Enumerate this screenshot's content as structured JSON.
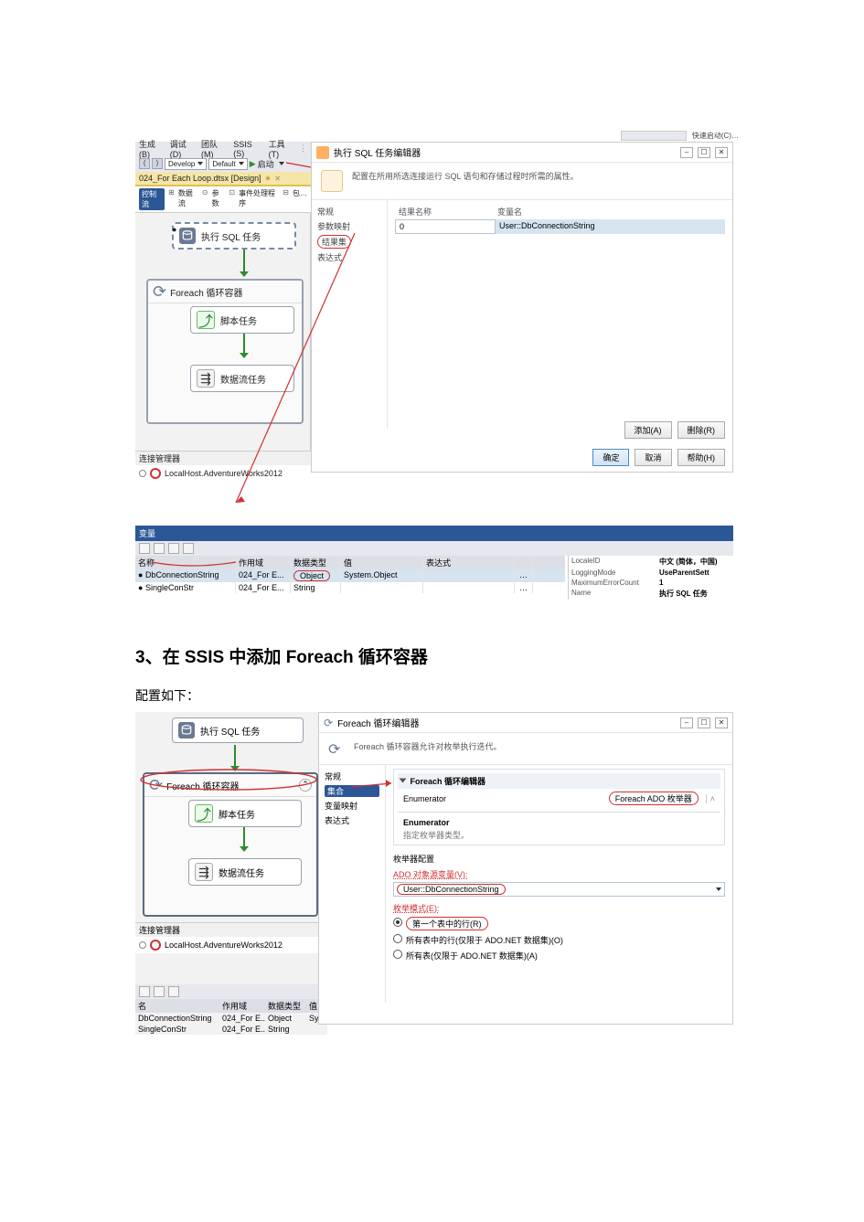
{
  "shot1": {
    "titlebar_hint": "快速启动(C)…",
    "menu": [
      "生成(B)",
      "调试(D)",
      "团队(M)",
      "SSIS (S)",
      "工具(T)"
    ],
    "toolbar": {
      "config": "Develop",
      "platform": "Default",
      "start": "启动"
    },
    "tab": "024_For Each Loop.dtsx [Design]",
    "subtabs": {
      "sel": "控制流",
      "others": [
        "数据流",
        "参数",
        "事件处理程序",
        "包…"
      ],
      "icons": [
        "⊞",
        "⊙",
        "⊡",
        "⊟"
      ]
    },
    "designer": {
      "sql_task": "执行 SQL 任务",
      "foreach": "Foreach 循环容器",
      "script": "脚本任务",
      "dataflow": "数据流任务"
    },
    "cm_label": "连接管理器",
    "connection": "LocalHost.AdventureWorks2012",
    "dialog": {
      "title": "执行 SQL 任务编辑器",
      "subtitle": "配置在所用所选连接运行 SQL 语句和存储过程时所需的属性。",
      "nav": [
        "常规",
        "参数映射",
        "结果集",
        "表达式"
      ],
      "col1": "结果名称",
      "col2": "变量名",
      "row_id": "0",
      "row_var": "User::DbConnectionString",
      "btn_add": "添加(A)",
      "btn_del": "删除(R)",
      "btn_ok": "确定",
      "btn_cancel": "取消",
      "btn_help": "帮助(H)"
    },
    "vars": {
      "title": "变量",
      "hdr": [
        "名称",
        "作用域",
        "数据类型",
        "值",
        "表达式",
        ""
      ],
      "rows": [
        {
          "name": "DbConnectionString",
          "scope": "024_For E...",
          "type": "Object",
          "value": "System.Object",
          "sel": true
        },
        {
          "name": "SingleConStr",
          "scope": "024_For E...",
          "type": "String",
          "value": "",
          "sel": false
        }
      ]
    },
    "props": {
      "rows": [
        {
          "k": "LocaleID",
          "v": "中文 (简体，中国)"
        },
        {
          "k": "LoggingMode",
          "v": "UseParentSett"
        },
        {
          "k": "MaximumErrorCount",
          "v": "1"
        },
        {
          "k": "Name",
          "v": "执行 SQL 任务"
        }
      ]
    }
  },
  "article": {
    "h3": "3、在 SSIS 中添加 Foreach 循环容器",
    "p1": "配置如下："
  },
  "shot2": {
    "designer": {
      "sql_task": "执行 SQL 任务",
      "foreach": "Foreach 循环容器",
      "script": "脚本任务",
      "dataflow": "数据流任务"
    },
    "cm_label": "连接管理器",
    "connection": "LocalHost.AdventureWorks2012",
    "dialog": {
      "title": "Foreach 循环编辑器",
      "subtitle": "Foreach 循环容器允许对枚举执行迭代。",
      "nav": [
        "常规",
        "集合",
        "变量映射",
        "表达式"
      ],
      "group": "Foreach 循环编辑器",
      "enum_label": "Enumerator",
      "enum_value": "Foreach ADO 枚举器",
      "enum_group": "Enumerator",
      "enum_desc": "指定枚举器类型。",
      "cfg_label": "枚举器配置",
      "ado_src_label": "ADO 对象源变量(V):",
      "ado_src_value": "User::DbConnectionString",
      "mode_label": "枚举模式(E):",
      "radio1": "第一个表中的行(R)",
      "radio2": "所有表中的行(仅限于 ADO.NET 数据集)(O)",
      "radio3": "所有表(仅限于 ADO.NET 数据集)(A)"
    },
    "vars": {
      "hdr": [
        "名",
        "作用域",
        "数据类型",
        "值"
      ],
      "rows": [
        {
          "name": "DbConnectionString",
          "scope": "024_For E...",
          "type": "Object",
          "value": "Syste"
        },
        {
          "name": "SingleConStr",
          "scope": "024_For E...",
          "type": "String",
          "value": ""
        }
      ]
    }
  }
}
